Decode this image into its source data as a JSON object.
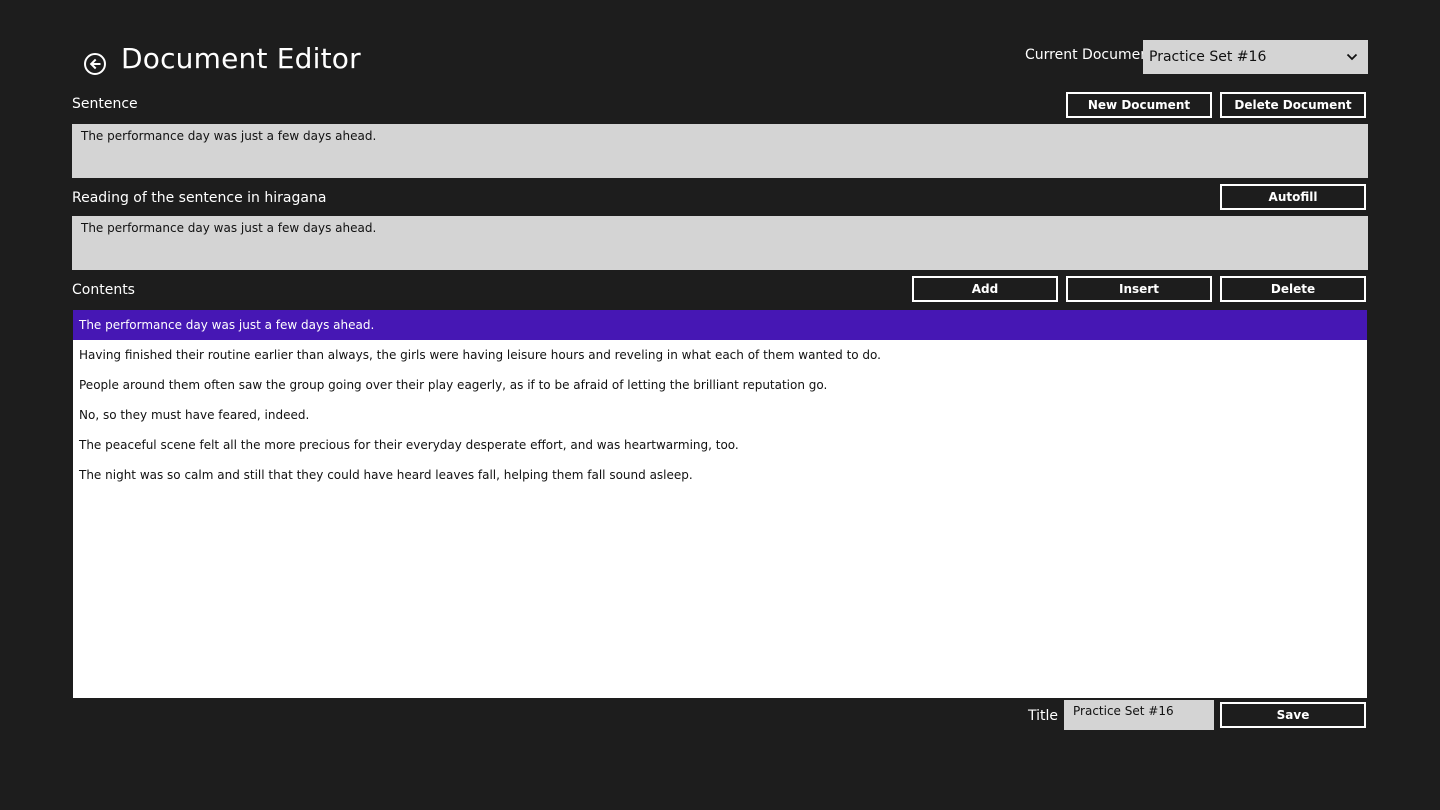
{
  "header": {
    "title": "Document Editor",
    "current_document_label": "Current Document",
    "current_document_value": "Practice Set #16"
  },
  "sentence": {
    "label": "Sentence",
    "value": "The performance day was just a few days ahead.",
    "new_document_label": "New Document",
    "delete_document_label": "Delete Document"
  },
  "reading": {
    "label": "Reading of the sentence in hiragana",
    "value": "The performance day was just a few days ahead.",
    "autofill_label": "Autofill"
  },
  "contents": {
    "label": "Contents",
    "add_label": "Add",
    "insert_label": "Insert",
    "delete_label": "Delete",
    "selected_index": 0,
    "items": [
      "The performance day was just a few days ahead.",
      "Having finished their routine earlier than always, the girls were having leisure hours and reveling in what each of them wanted to do.",
      "People around them often saw the group going over their play eagerly, as if to be afraid of letting the brilliant reputation go.",
      "No, so they must have feared, indeed.",
      "The peaceful scene felt all the more precious for their everyday desperate effort, and was heartwarming, too.",
      "The night was so calm and still that they could have heard leaves fall, helping them fall sound asleep."
    ]
  },
  "footer": {
    "title_label": "Title",
    "title_value": "Practice Set #16",
    "save_label": "Save"
  },
  "colors": {
    "background": "#1d1d1d",
    "field": "#d4d4d4",
    "selection": "#4617b4"
  },
  "icons": {
    "back": "back-arrow-circle-icon",
    "dropdown": "chevron-down-icon"
  }
}
